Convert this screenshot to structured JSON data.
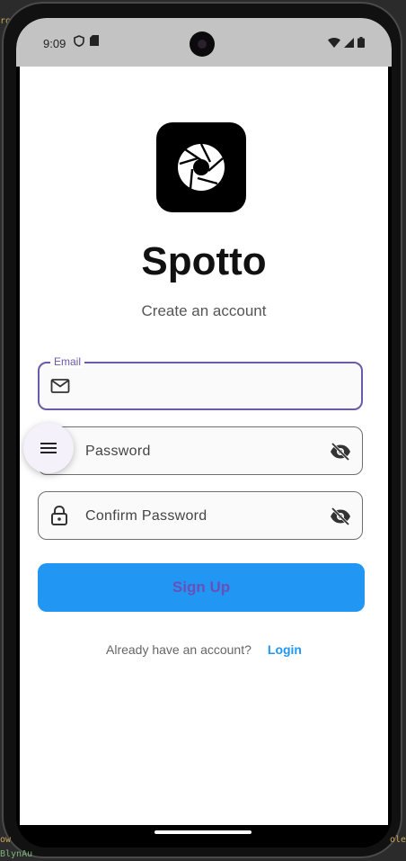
{
  "statusbar": {
    "time": "9:09"
  },
  "app": {
    "title": "Spotto",
    "subtitle": "Create an account"
  },
  "form": {
    "email": {
      "label": "Email",
      "value": ""
    },
    "password": {
      "placeholder": "Password"
    },
    "confirm_password": {
      "placeholder": "Confirm Password"
    },
    "signup_label": "Sign Up"
  },
  "footer": {
    "prompt": "Already have an account?",
    "login_label": "Login"
  },
  "colors": {
    "primary_button": "#2196f3",
    "focus_border": "#6c5aa8",
    "login_link": "#2196f3"
  },
  "icons": [
    "shield-icon",
    "sim-card-icon",
    "wifi-icon",
    "signal-icon",
    "battery-icon",
    "aperture-icon",
    "mail-icon",
    "lock-icon",
    "visibility-off-icon",
    "menu-icon"
  ]
}
